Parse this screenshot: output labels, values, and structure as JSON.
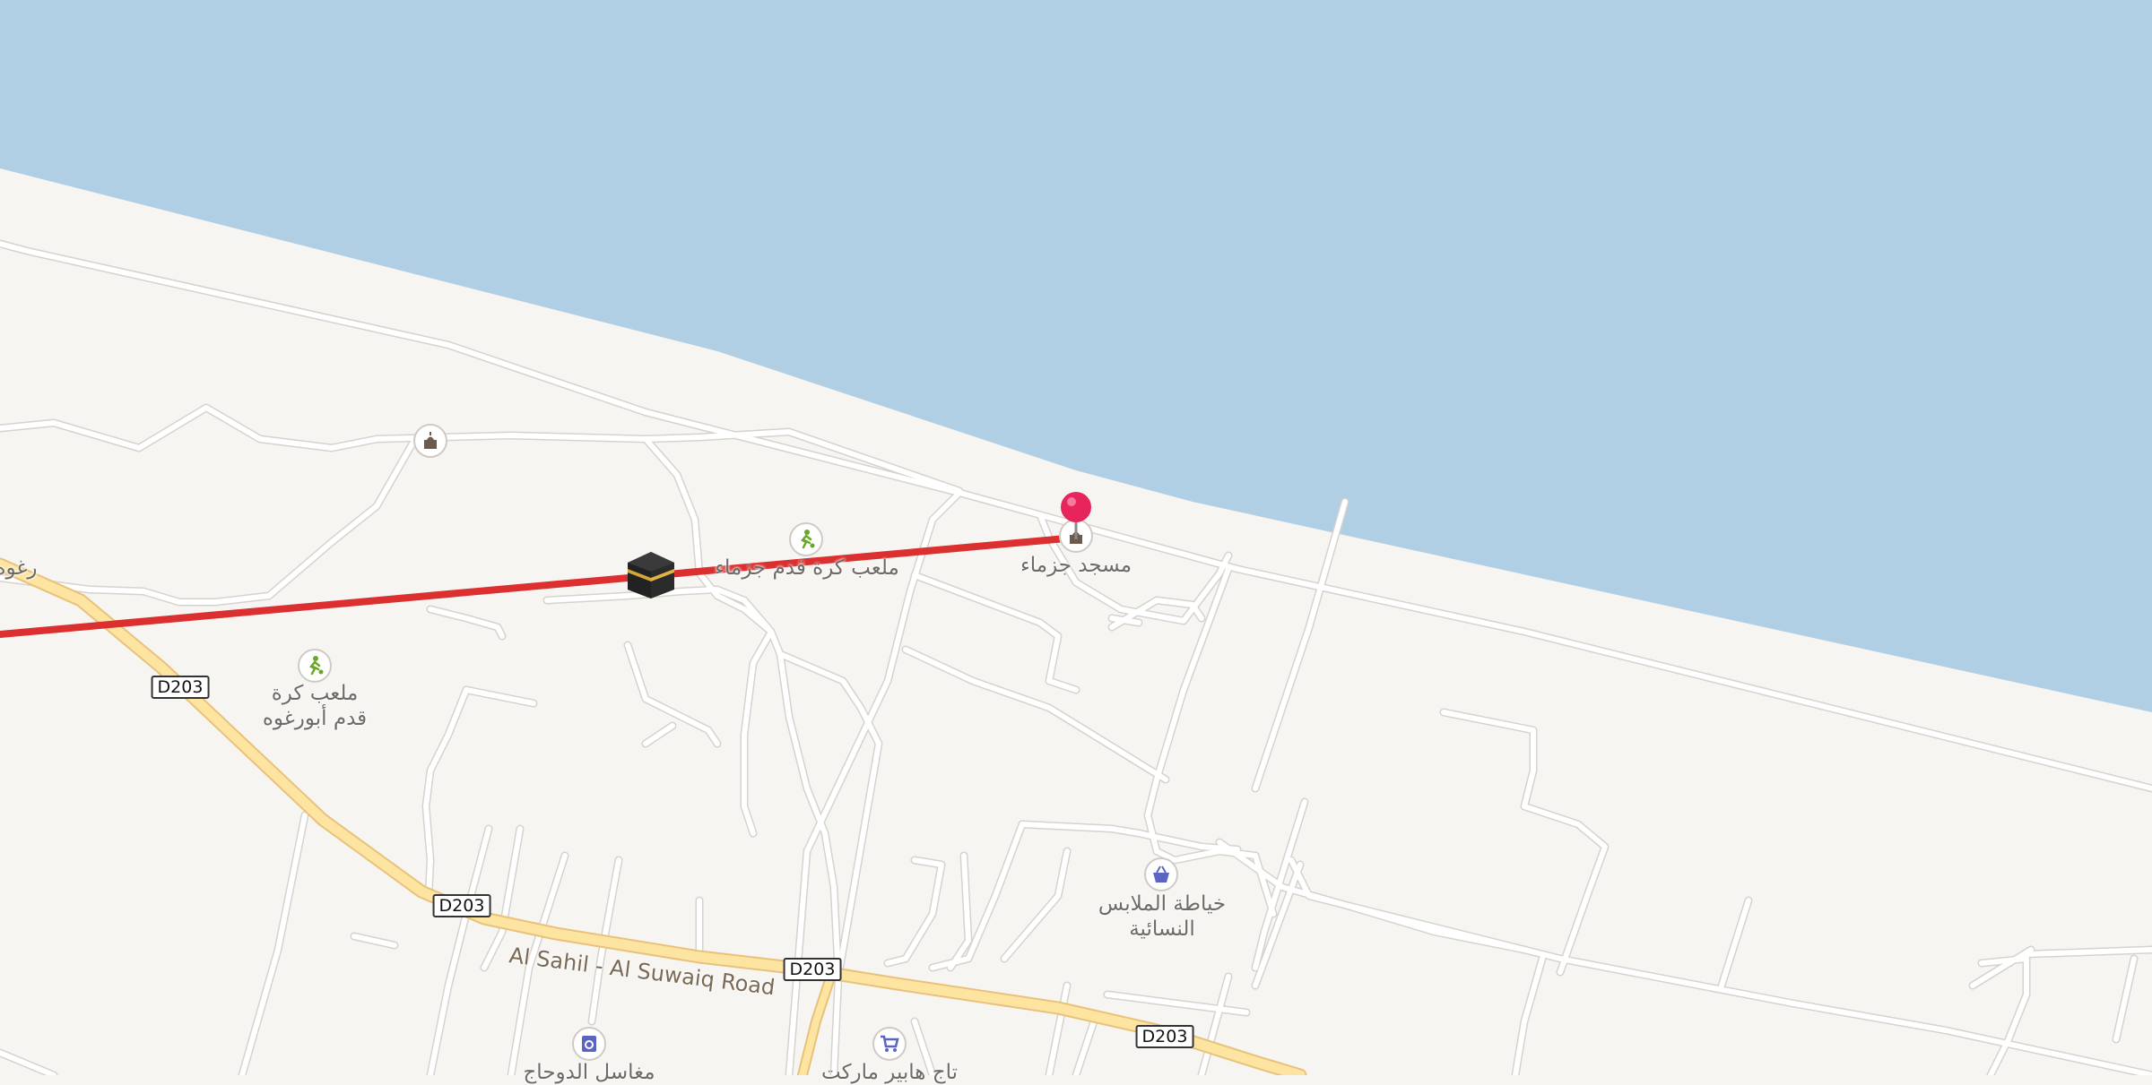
{
  "map": {
    "colors": {
      "water": "#b0cfe4",
      "land": "#f7f5f2",
      "road": "#ffffff",
      "road_casing": "#d9d5d0",
      "primary_road": "#fde4a1",
      "primary_casing": "#e8c27a",
      "route": "#dc2f2f",
      "pin": "#e8245c"
    },
    "road_name": "Al Sahil - Al Suwaiq Road",
    "shields": [
      "D203",
      "D203",
      "D203",
      "D203"
    ],
    "labels": {
      "mosque": "مسجد جزماء",
      "football_jazma": "ملعب كرة قدم جزماء",
      "football_aburgha_1": "ملعب كرة",
      "football_aburgha_2": "قدم أبورغوه",
      "edge_left": "رغوه",
      "tailoring_1": "خياطة الملابس",
      "tailoring_2": "النسائية",
      "bottom_left": "مغاسل الدوحاج",
      "bottom_mid": "تاج هابير ماركت"
    },
    "icons": [
      "mosque-icon",
      "football-icon",
      "kaaba-icon",
      "shopping-basket-icon",
      "shopping-cart-icon",
      "laundry-icon",
      "location-pin-icon"
    ]
  }
}
